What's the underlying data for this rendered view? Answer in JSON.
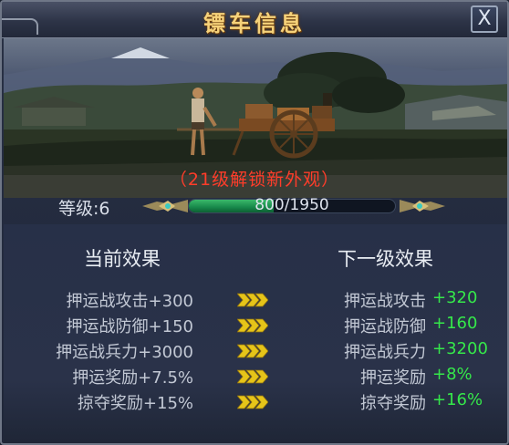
{
  "window": {
    "title": "镖车信息",
    "close_label": "X"
  },
  "scene": {
    "unlock_note": "（21级解锁新外观）"
  },
  "level": {
    "label": "等级:",
    "value": "6",
    "progress_text": "800/1950",
    "progress_fraction": 0.41
  },
  "effects": {
    "current_header": "当前效果",
    "next_header": "下一级效果",
    "rows": [
      {
        "current": "押运战攻击+300",
        "next_name": "押运战攻击",
        "next_value": "+320"
      },
      {
        "current": "押运战防御+150",
        "next_name": "押运战防御",
        "next_value": "+160"
      },
      {
        "current": "押运战兵力+3000",
        "next_name": "押运战兵力",
        "next_value": "+3200"
      },
      {
        "current": "押运奖励+7.5%",
        "next_name": "押运奖励",
        "next_value": "+8%"
      },
      {
        "current": "掠夺奖励+15%",
        "next_name": "掠夺奖励",
        "next_value": "+16%"
      }
    ]
  },
  "colors": {
    "title": "#f6d27a",
    "unlock_note": "#ff3d2a",
    "next_value": "#35e84a",
    "arrow": "#e6c419",
    "bar_fill": "#17884a"
  }
}
